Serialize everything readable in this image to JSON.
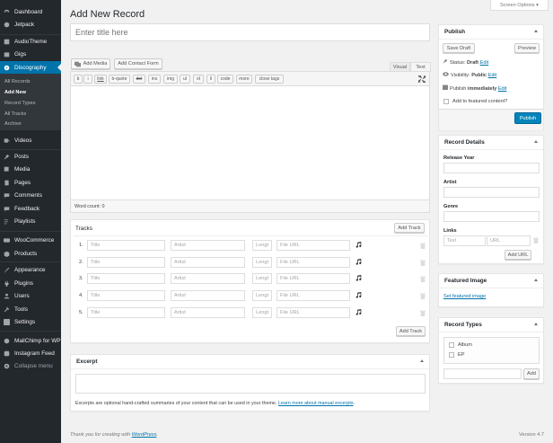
{
  "colors": {
    "sidebar_bg": "#23282d",
    "active_bg": "#0073aa",
    "primary_button": "#0085ba",
    "link": "#0073aa"
  },
  "sidebar": {
    "items": [
      {
        "label": "Dashboard",
        "icon": "dashboard-icon"
      },
      {
        "label": "Jetpack",
        "icon": "jetpack-icon"
      },
      {
        "label": "AudioTheme",
        "icon": "audiotheme-icon"
      },
      {
        "label": "Gigs",
        "icon": "gigs-icon"
      },
      {
        "label": "Discography",
        "icon": "discography-icon"
      },
      {
        "label": "Videos",
        "icon": "video-icon"
      },
      {
        "label": "Posts",
        "icon": "pin-icon"
      },
      {
        "label": "Media",
        "icon": "media-icon"
      },
      {
        "label": "Pages",
        "icon": "pages-icon"
      },
      {
        "label": "Comments",
        "icon": "comments-icon"
      },
      {
        "label": "Feedback",
        "icon": "feedback-icon"
      },
      {
        "label": "Playlists",
        "icon": "playlist-icon"
      },
      {
        "label": "WooCommerce",
        "icon": "woocommerce-icon"
      },
      {
        "label": "Products",
        "icon": "products-icon"
      },
      {
        "label": "Appearance",
        "icon": "appearance-icon"
      },
      {
        "label": "Plugins",
        "icon": "plugins-icon"
      },
      {
        "label": "Users",
        "icon": "users-icon"
      },
      {
        "label": "Tools",
        "icon": "tools-icon"
      },
      {
        "label": "Settings",
        "icon": "settings-icon"
      },
      {
        "label": "MailChimp for WP",
        "icon": "mailchimp-icon"
      },
      {
        "label": "Instagram Feed",
        "icon": "instagram-icon"
      },
      {
        "label": "Collapse menu",
        "icon": "collapse-icon"
      }
    ],
    "submenu": [
      "All Records",
      "Add New",
      "Record Types",
      "All Tracks",
      "Archive"
    ]
  },
  "screen_options": "Screen Options ▾",
  "page_title": "Add New Record",
  "title_placeholder": "Enter title here",
  "editor": {
    "add_media": "Add Media",
    "add_contact_form": "Add Contact Form",
    "tab_visual": "Visual",
    "tab_text": "Text",
    "quicktags": [
      "b",
      "i",
      "link",
      "b-quote",
      "del",
      "ins",
      "img",
      "ul",
      "ol",
      "li",
      "code",
      "more",
      "close tags"
    ],
    "word_count": "Word count: 0"
  },
  "tracks": {
    "title": "Tracks",
    "add_track": "Add Track",
    "rows": [
      "1.",
      "2.",
      "3.",
      "4.",
      "5."
    ],
    "placeholder_title": "Title",
    "placeholder_artist": "Artist",
    "placeholder_length": "Lengt",
    "placeholder_file": "File URL"
  },
  "excerpt": {
    "title": "Excerpt",
    "help": "Excerpts are optional hand-crafted summaries of your content that can be used in your theme.",
    "help_link": "Learn more about manual excerpts",
    "help_end": "."
  },
  "publish": {
    "title": "Publish",
    "save_draft": "Save Draft",
    "preview": "Preview",
    "status_label": "Status:",
    "status_value": "Draft",
    "visibility_label": "Visibility:",
    "visibility_value": "Public",
    "publish_label": "Publish",
    "publish_value": "immediately",
    "edit": "Edit",
    "featured": "Add to featured content?",
    "publish_button": "Publish"
  },
  "record_details": {
    "title": "Record Details",
    "release_year": "Release Year",
    "artist": "Artist",
    "genre": "Genre",
    "links": "Links",
    "link_text_placeholder": "Text",
    "link_url_placeholder": "URL",
    "add_url": "Add URL"
  },
  "featured_image": {
    "title": "Featured Image",
    "set": "Set featured image"
  },
  "record_types": {
    "title": "Record Types",
    "options": [
      "Album",
      "EP"
    ],
    "add": "Add"
  },
  "footer": {
    "thanks": "Thank you for creating with",
    "wp_link": "WordPress",
    "version": "Version 4.7"
  }
}
